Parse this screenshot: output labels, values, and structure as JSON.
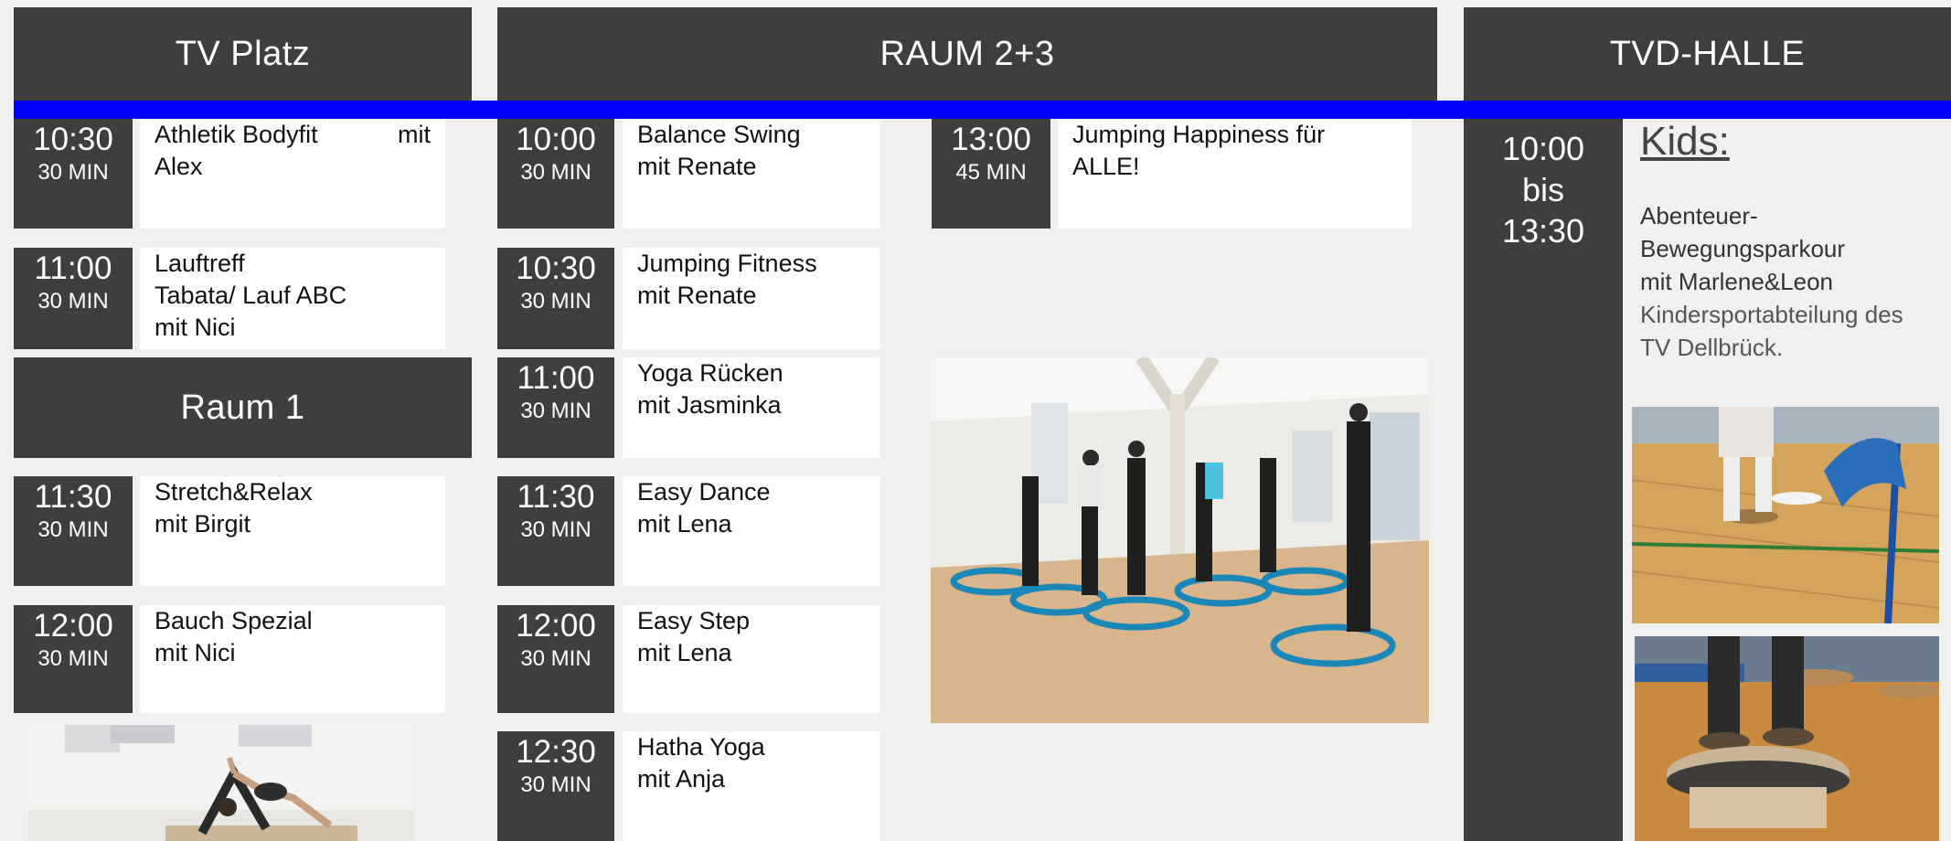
{
  "headers": {
    "tv_platz": "TV Platz",
    "raum23": "RAUM 2+3",
    "tvd_halle": "TVD-HALLE",
    "raum1": "Raum 1"
  },
  "tv_platz": [
    {
      "time": "10:30",
      "duration": "30 MIN",
      "title": "Athletik Bodyfit",
      "title_suffix": "mit",
      "line2": "Alex"
    },
    {
      "time": "11:00",
      "duration": "30 MIN",
      "line1": "Lauftreff",
      "line2": "Tabata/ Lauf ABC",
      "line3": "mit Nici"
    }
  ],
  "raum1": [
    {
      "time": "11:30",
      "duration": "30 MIN",
      "line1": "Stretch&Relax",
      "line2": "mit Birgit"
    },
    {
      "time": "12:00",
      "duration": "30 MIN",
      "line1": "Bauch Spezial",
      "line2": "mit Nici"
    }
  ],
  "raum23_left": [
    {
      "time": "10:00",
      "duration": "30 MIN",
      "line1": "Balance Swing",
      "line2": "mit Renate"
    },
    {
      "time": "10:30",
      "duration": "30 MIN",
      "line1": "Jumping Fitness",
      "line2": "mit Renate"
    },
    {
      "time": "11:00",
      "duration": "30 MIN",
      "line1": "Yoga Rücken",
      "line2": "mit Jasminka"
    },
    {
      "time": "11:30",
      "duration": "30 MIN",
      "line1": "Easy Dance",
      "line2": "mit Lena"
    },
    {
      "time": "12:00",
      "duration": "30 MIN",
      "line1": "Easy Step",
      "line2": "mit Lena"
    },
    {
      "time": "12:30",
      "duration": "30 MIN",
      "line1": "Hatha Yoga",
      "line2": "mit Anja"
    }
  ],
  "raum23_right": [
    {
      "time": "13:00",
      "duration": "45 MIN",
      "line1": "Jumping Happiness für",
      "line2": "ALLE!"
    }
  ],
  "kids": {
    "time_from": "10:00",
    "time_sep": "bis",
    "time_to": "13:30",
    "title": "Kids:",
    "line1": "Abenteuer-",
    "line2": "Bewegungsparkour",
    "line3": "mit Marlene&Leon",
    "line4": "Kindersportabteilung des",
    "line5": "TV Dellbrück."
  },
  "colors": {
    "header_bg": "#3e3e3e",
    "accent_band": "#0000ff",
    "page_bg": "#f0f0f0"
  }
}
